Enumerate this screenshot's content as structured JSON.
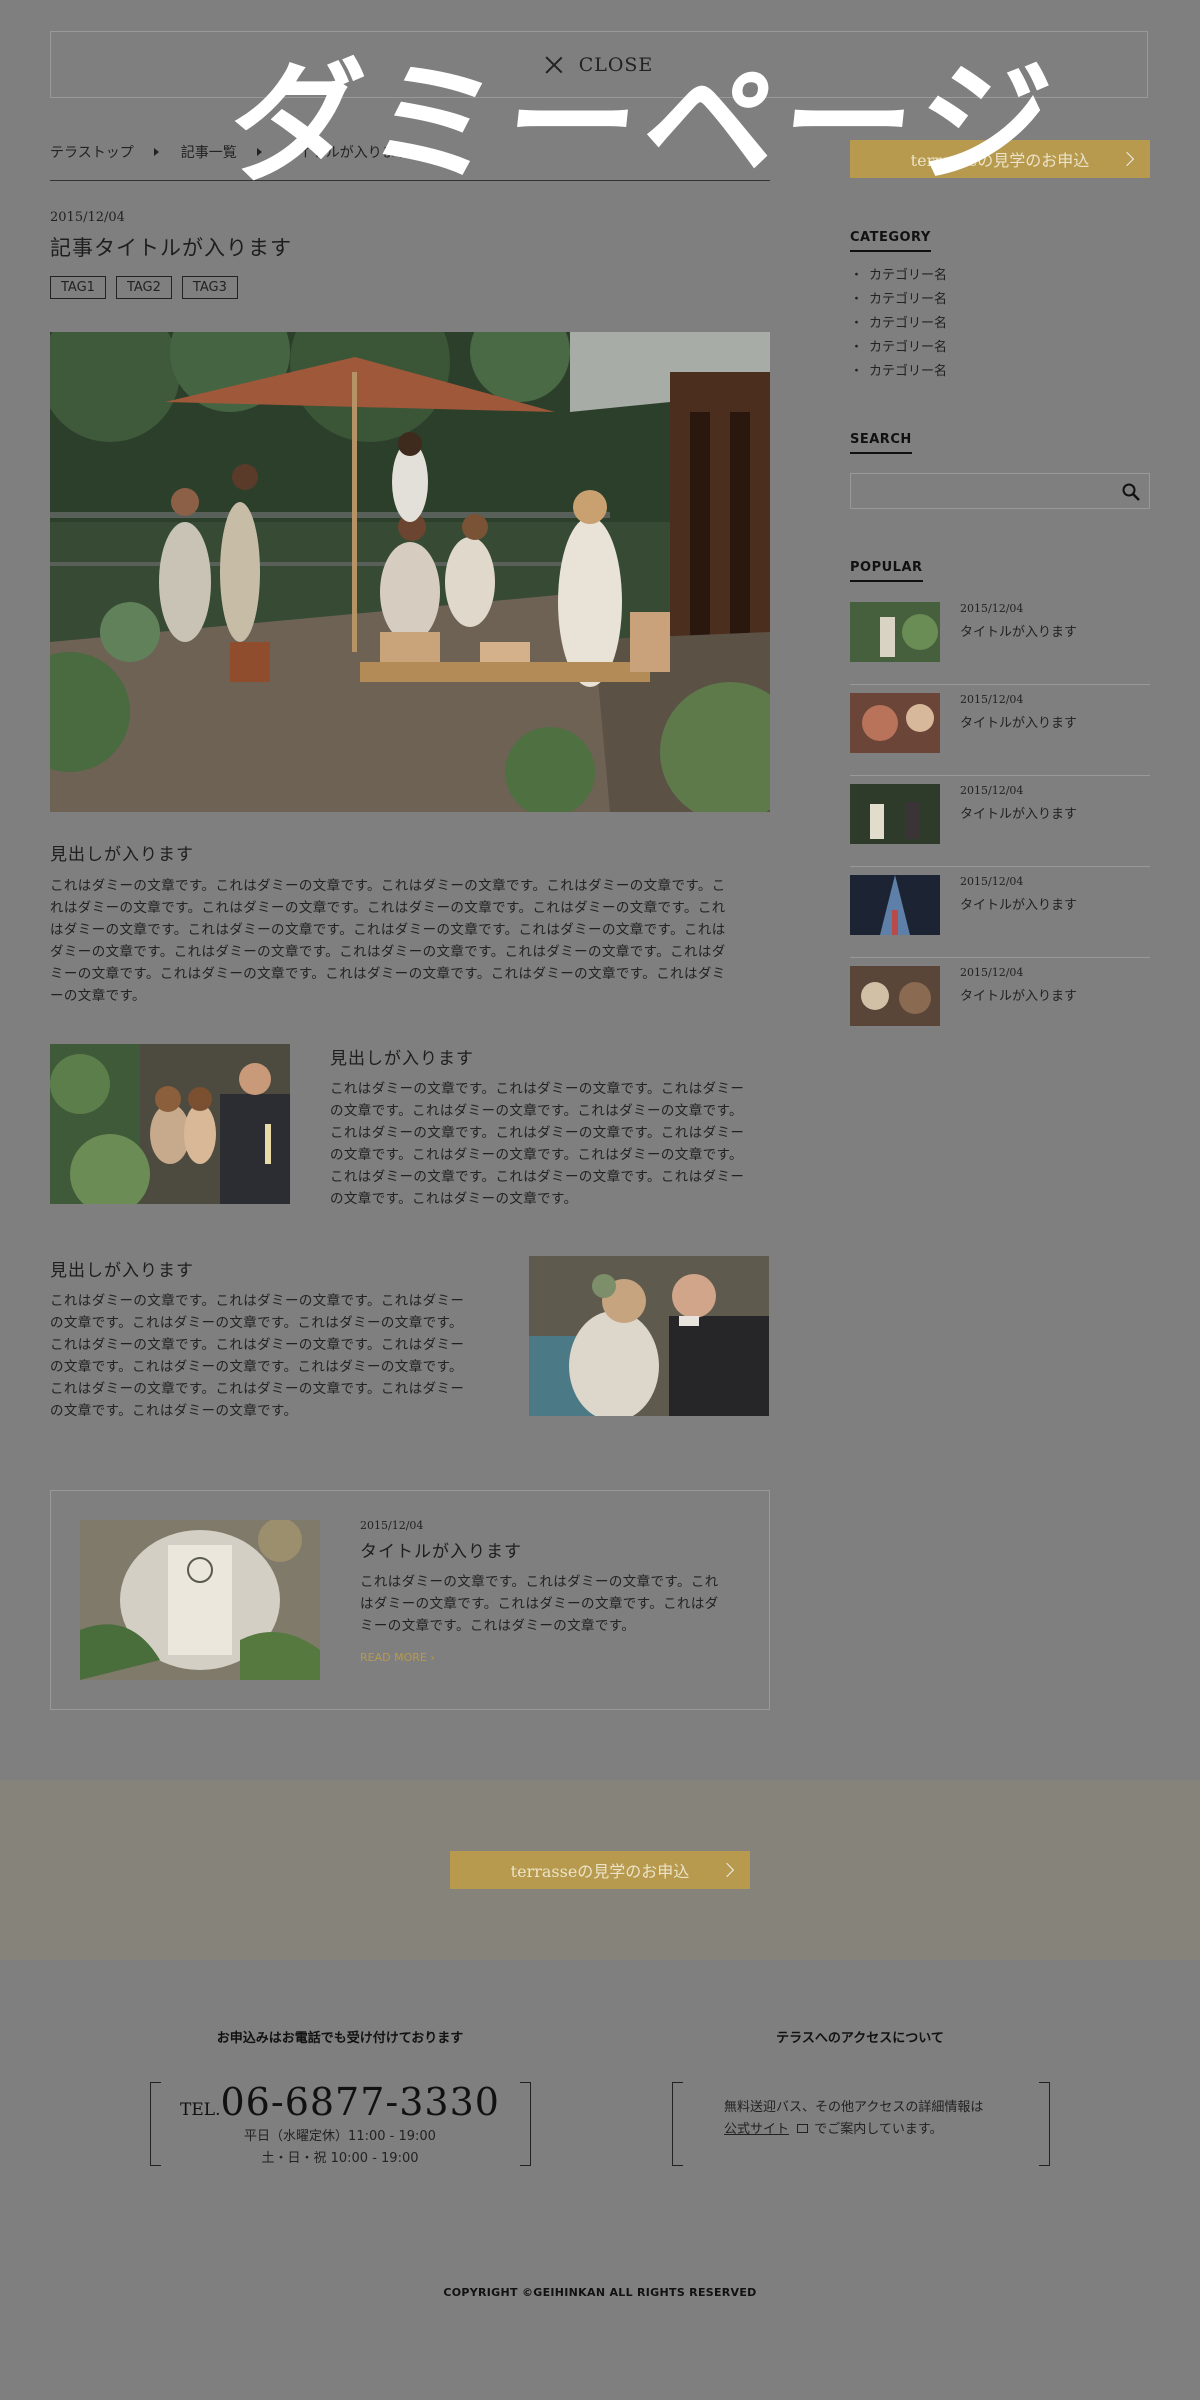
{
  "close_bar": {
    "label": "CLOSE"
  },
  "watermark": "ダミーページ",
  "breadcrumb": {
    "items": [
      "テラストップ",
      "記事一覧",
      "タイトルが入ります"
    ]
  },
  "article": {
    "date": "2015/12/04",
    "title": "記事タイトルが入ります",
    "tags": [
      "TAG1",
      "TAG2",
      "TAG3"
    ],
    "section1": {
      "heading": "見出しが入ります",
      "lines": [
        "これはダミーの文章です。これはダミーの文章です。これはダミーの文章です。これはダミーの文章です。こ",
        "れはダミーの文章です。これはダミーの文章です。これはダミーの文章です。これはダミーの文章です。これ",
        "はダミーの文章です。これはダミーの文章です。これはダミーの文章です。これはダミーの文章です。これは",
        "ダミーの文章です。これはダミーの文章です。これはダミーの文章です。これはダミーの文章です。これはダ",
        "ミーの文章です。これはダミーの文章です。これはダミーの文章です。これはダミーの文章です。これはダミ",
        "ーの文章です。"
      ]
    },
    "section2": {
      "heading": "見出しが入ります",
      "lines": [
        "これはダミーの文章です。これはダミーの文章です。これはダミー",
        "の文章です。これはダミーの文章です。これはダミーの文章です。",
        "これはダミーの文章です。これはダミーの文章です。これはダミー",
        "の文章です。これはダミーの文章です。これはダミーの文章です。",
        "これはダミーの文章です。これはダミーの文章です。これはダミー",
        "の文章です。これはダミーの文章です。"
      ]
    },
    "section3": {
      "heading": "見出しが入ります",
      "lines": [
        "これはダミーの文章です。これはダミーの文章です。これはダミー",
        "の文章です。これはダミーの文章です。これはダミーの文章です。",
        "これはダミーの文章です。これはダミーの文章です。これはダミー",
        "の文章です。これはダミーの文章です。これはダミーの文章です。",
        "これはダミーの文章です。これはダミーの文章です。これはダミー",
        "の文章です。これはダミーの文章です。"
      ]
    }
  },
  "related_card": {
    "date": "2015/12/04",
    "title": "タイトルが入ります",
    "lines": [
      "これはダミーの文章です。これはダミーの文章です。これ",
      "はダミーの文章です。これはダミーの文章です。これはダ",
      "ミーの文章です。これはダミーの文章です。"
    ],
    "read_more": "READ MORE"
  },
  "sidebar": {
    "apply_button": "terrasseの見学のお申込",
    "category": {
      "heading": "CATEGORY",
      "items": [
        "カテゴリー名",
        "カテゴリー名",
        "カテゴリー名",
        "カテゴリー名",
        "カテゴリー名"
      ]
    },
    "search": {
      "heading": "SEARCH",
      "placeholder": ""
    },
    "popular": {
      "heading": "POPULAR",
      "items": [
        {
          "date": "2015/12/04",
          "title": "タイトルが入ります"
        },
        {
          "date": "2015/12/04",
          "title": "タイトルが入ります"
        },
        {
          "date": "2015/12/04",
          "title": "タイトルが入ります"
        },
        {
          "date": "2015/12/04",
          "title": "タイトルが入ります"
        },
        {
          "date": "2015/12/04",
          "title": "タイトルが入ります"
        }
      ]
    }
  },
  "band": {
    "apply_button": "terrasseの見学のお申込"
  },
  "footer": {
    "phone": {
      "heading": "お申込みはお電話でも受け付けております",
      "tel_prefix": "TEL.",
      "number": "06-6877-3330",
      "hours_weekday": "平日（水曜定休）11:00 - 19:00",
      "hours_weekend": "土・日・祝 10:00 - 19:00"
    },
    "access": {
      "heading": "テラスへのアクセスについて",
      "line1": "無料送迎バス、その他アクセスの詳細情報は",
      "link": "公式サイト",
      "line2_suffix": " でご案内しています。"
    },
    "copyright": "COPYRIGHT ©GEIHINKAN ALL RIGHTS RESERVED"
  },
  "colors": {
    "accent": "#b79a4e",
    "overlay": "#7f7f7f"
  }
}
